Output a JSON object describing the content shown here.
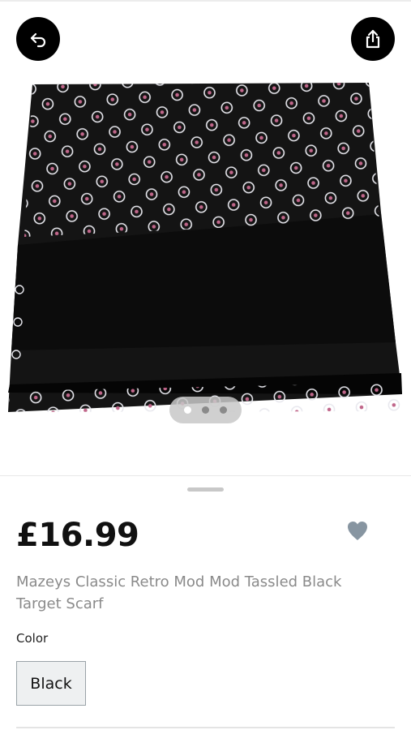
{
  "product": {
    "price": "£16.99",
    "title": "Mazeys Classic Retro Mod Mod Tassled Black Target Scarf",
    "color_label": "Color",
    "selected_color": "Black",
    "image_count": 3,
    "active_image_index": 0,
    "favorited": false
  },
  "icons": {
    "back": "back-arrow-icon",
    "share": "share-icon",
    "favorite": "heart-icon"
  },
  "colors": {
    "button_bg": "#000000",
    "price_text": "#111111",
    "title_text": "#8a8a8a",
    "heart": "#8795a1",
    "chip_bg": "#eef0f1",
    "chip_border": "#9aa3a8"
  }
}
